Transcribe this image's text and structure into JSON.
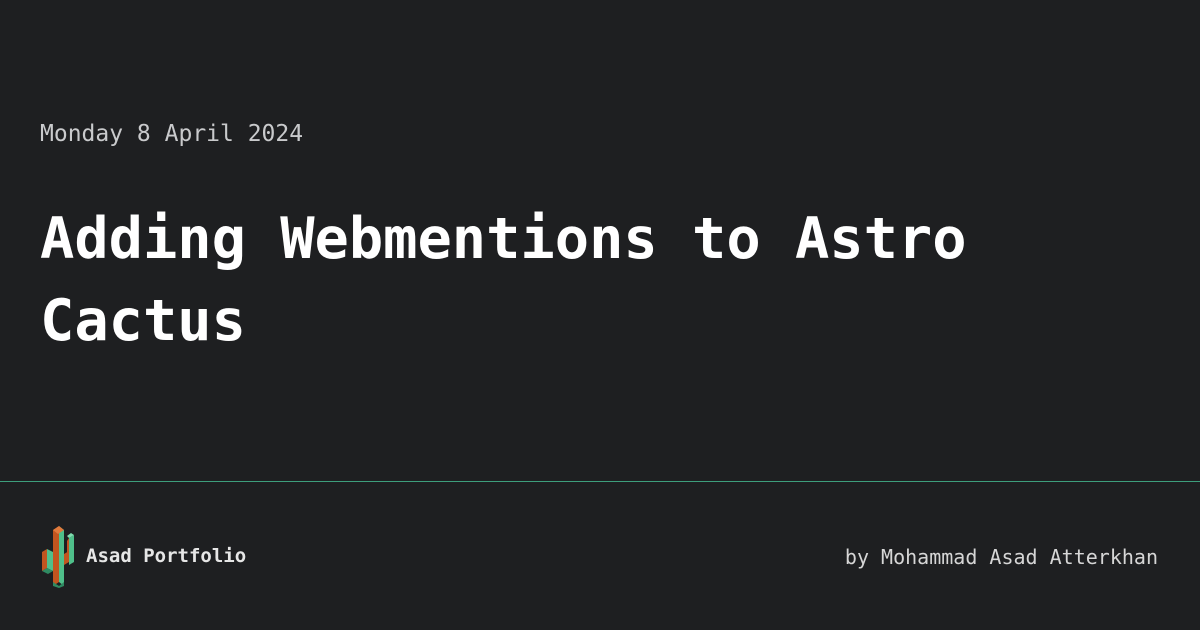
{
  "post": {
    "date": "Monday 8 April 2024",
    "title": "Adding Webmentions to Astro Cactus"
  },
  "footer": {
    "site_name": "Asad Portfolio",
    "author_line": "by Mohammad Asad Atterkhan",
    "logo_icon": "cactus-logo-icon"
  },
  "colors": {
    "background": "#1e1f21",
    "divider": "#3d9e7c",
    "logo_green": "#4fbf8a",
    "logo_orange": "#c2551f"
  }
}
